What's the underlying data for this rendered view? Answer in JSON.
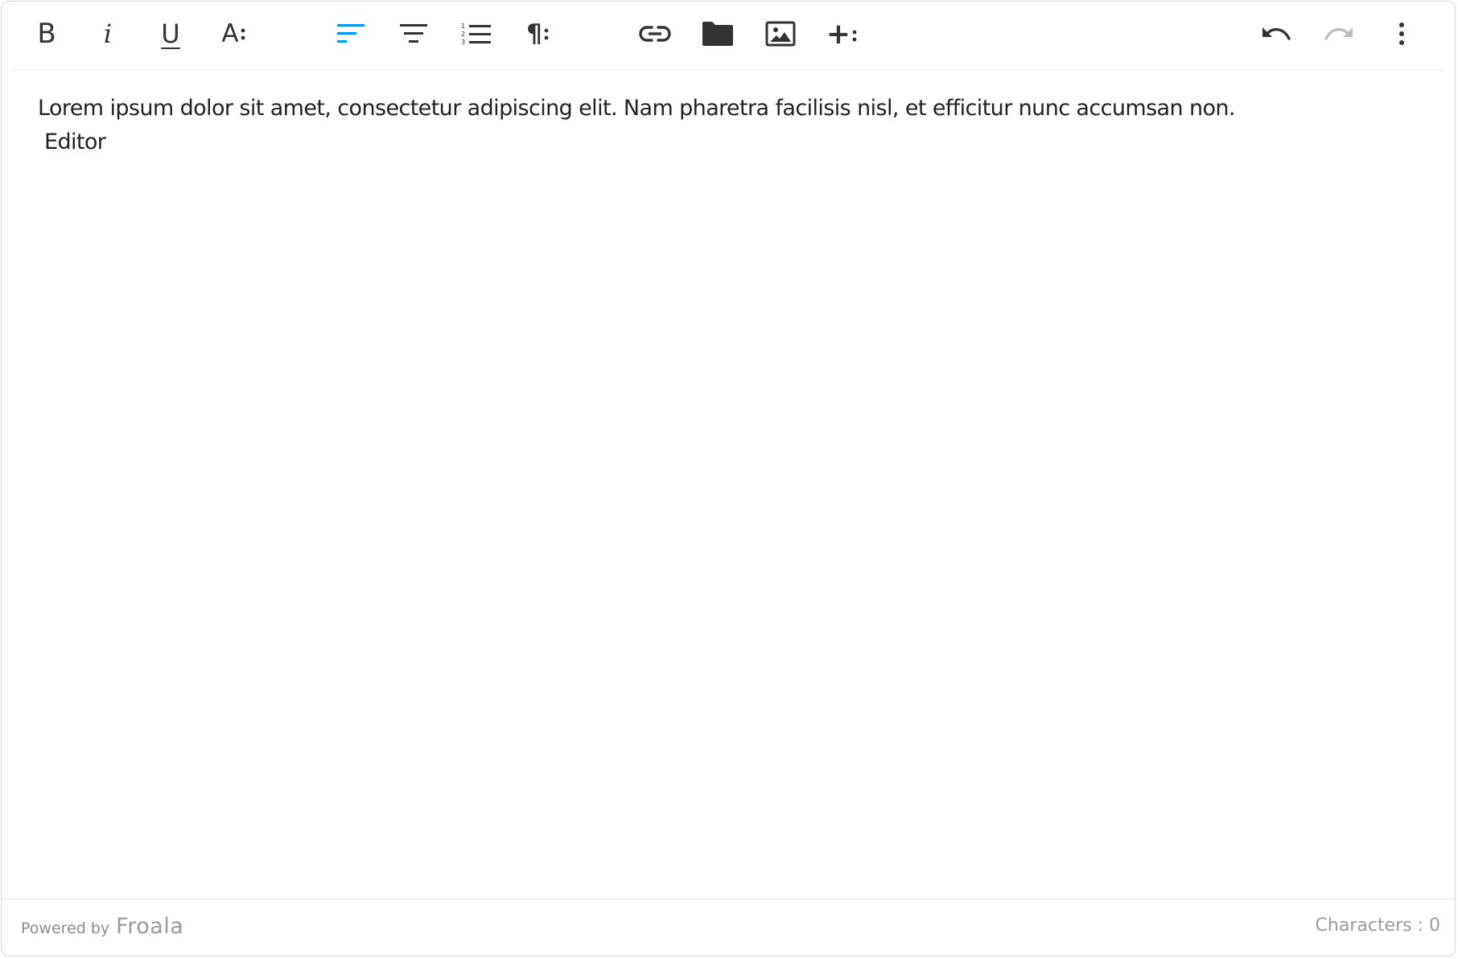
{
  "toolbar": {
    "buttons": [
      {
        "name": "bold-button",
        "icon": "bold-icon",
        "glyph": "B"
      },
      {
        "name": "italic-button",
        "icon": "italic-icon",
        "glyph": "i"
      },
      {
        "name": "underline-button",
        "icon": "underline-icon",
        "glyph": "U"
      },
      {
        "name": "text-more-button",
        "icon": "font-more-icon",
        "glyph": "A"
      },
      {
        "name": "align-left-button",
        "icon": "align-left-icon",
        "active": true
      },
      {
        "name": "align-center-button",
        "icon": "align-center-icon"
      },
      {
        "name": "ordered-list-button",
        "icon": "ordered-list-icon"
      },
      {
        "name": "paragraph-more-button",
        "icon": "paragraph-icon",
        "glyph": "¶"
      },
      {
        "name": "insert-link-button",
        "icon": "link-icon"
      },
      {
        "name": "insert-file-button",
        "icon": "folder-icon"
      },
      {
        "name": "insert-image-button",
        "icon": "image-icon"
      },
      {
        "name": "insert-more-button",
        "icon": "plus-more-icon",
        "glyph": "+"
      },
      {
        "name": "undo-button",
        "icon": "undo-icon"
      },
      {
        "name": "redo-button",
        "icon": "redo-icon",
        "disabled": true
      },
      {
        "name": "more-options-button",
        "icon": "vertical-dots-icon"
      }
    ],
    "active_color": "#0098f7",
    "icon_color": "#333333",
    "disabled_color": "#bdbdbd"
  },
  "content": {
    "line1": "Lorem ipsum dolor sit amet, consectetur adipiscing elit. Nam pharetra facilisis nisl, et efficitur nunc accumsan non.",
    "line2": " Editor"
  },
  "footer": {
    "powered_by": "Powered by",
    "brand": "Froala",
    "char_count": "Characters : 0"
  }
}
